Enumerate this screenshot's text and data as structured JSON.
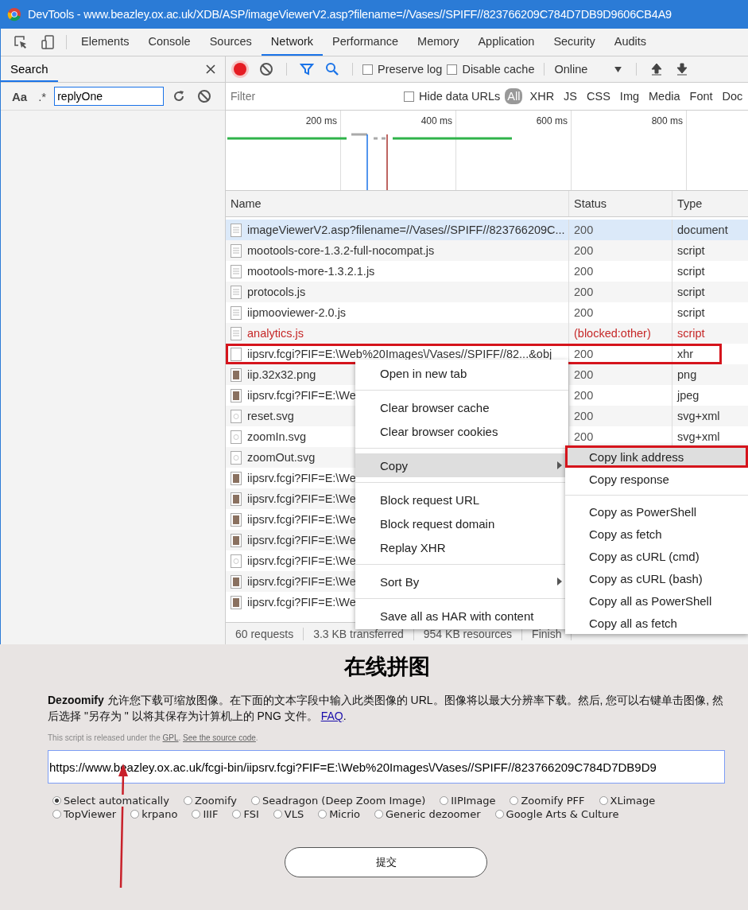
{
  "window": {
    "title": "DevTools - www.beazley.ox.ac.uk/XDB/ASP/imageViewerV2.asp?filename=//Vases//SPIFF//823766209C784D7DB9D9606CB4A9"
  },
  "devtools_tabs": [
    {
      "label": "Elements",
      "selected": false
    },
    {
      "label": "Console",
      "selected": false
    },
    {
      "label": "Sources",
      "selected": false
    },
    {
      "label": "Network",
      "selected": true
    },
    {
      "label": "Performance",
      "selected": false
    },
    {
      "label": "Memory",
      "selected": false
    },
    {
      "label": "Application",
      "selected": false
    },
    {
      "label": "Security",
      "selected": false
    },
    {
      "label": "Audits",
      "selected": false
    }
  ],
  "search_panel": {
    "title": "Search",
    "case_toggle": "Aa",
    "regex_toggle": ".*",
    "query": "replyOne"
  },
  "network_toolbar": {
    "recording": true,
    "preserve_log": {
      "label": "Preserve log",
      "checked": false
    },
    "disable_cache": {
      "label": "Disable cache",
      "checked": false
    },
    "throttling": "Online"
  },
  "filter_bar": {
    "placeholder": "Filter",
    "hide_data_urls": {
      "label": "Hide data URLs",
      "checked": false
    },
    "types": [
      {
        "label": "All",
        "selected": true
      },
      {
        "label": "XHR",
        "selected": false
      },
      {
        "label": "JS",
        "selected": false
      },
      {
        "label": "CSS",
        "selected": false
      },
      {
        "label": "Img",
        "selected": false
      },
      {
        "label": "Media",
        "selected": false
      },
      {
        "label": "Font",
        "selected": false
      },
      {
        "label": "Doc",
        "selected": false
      }
    ]
  },
  "timeline": {
    "ticks": [
      "200 ms",
      "400 ms",
      "600 ms",
      "800 ms"
    ]
  },
  "table": {
    "columns": [
      "Name",
      "Status",
      "Type"
    ],
    "rows": [
      {
        "kind": "file",
        "name": "imageViewerV2.asp?filename=//Vases//SPIFF//823766209C...",
        "status": "200",
        "type": "document",
        "error": false,
        "selected": true,
        "annotated": false
      },
      {
        "kind": "file",
        "name": "mootools-core-1.3.2-full-nocompat.js",
        "status": "200",
        "type": "script",
        "error": false,
        "selected": false,
        "annotated": false
      },
      {
        "kind": "file",
        "name": "mootools-more-1.3.2.1.js",
        "status": "200",
        "type": "script",
        "error": false,
        "selected": false,
        "annotated": false
      },
      {
        "kind": "file",
        "name": "protocols.js",
        "status": "200",
        "type": "script",
        "error": false,
        "selected": false,
        "annotated": false
      },
      {
        "kind": "file",
        "name": "iipmooviewer-2.0.js",
        "status": "200",
        "type": "script",
        "error": false,
        "selected": false,
        "annotated": false
      },
      {
        "kind": "file",
        "name": "analytics.js",
        "status": "(blocked:other)",
        "type": "script",
        "error": true,
        "selected": false,
        "annotated": false
      },
      {
        "kind": "blank",
        "name": "iipsrv.fcgi?FIF=E:\\Web%20Images\\/Vases//SPIFF//82...&obj",
        "status": "200",
        "type": "xhr",
        "error": false,
        "selected": false,
        "annotated": true
      },
      {
        "kind": "thumb",
        "name": "iip.32x32.png",
        "status": "200",
        "type": "png",
        "error": false,
        "selected": false,
        "annotated": false
      },
      {
        "kind": "thumb",
        "name": "iipsrv.fcgi?FIF=E:\\We",
        "status": "200",
        "type": "jpeg",
        "error": false,
        "selected": false,
        "annotated": false
      },
      {
        "kind": "svg",
        "name": "reset.svg",
        "status": "200",
        "type": "svg+xml",
        "error": false,
        "selected": false,
        "annotated": false
      },
      {
        "kind": "svg",
        "name": "zoomIn.svg",
        "status": "200",
        "type": "svg+xml",
        "error": false,
        "selected": false,
        "annotated": false
      },
      {
        "kind": "svg",
        "name": "zoomOut.svg",
        "error": false,
        "selected": false,
        "annotated": false
      },
      {
        "kind": "thumb",
        "name": "iipsrv.fcgi?FIF=E:\\We",
        "error": false,
        "selected": false,
        "annotated": false
      },
      {
        "kind": "thumb",
        "name": "iipsrv.fcgi?FIF=E:\\We",
        "error": false,
        "selected": false,
        "annotated": false
      },
      {
        "kind": "thumb",
        "name": "iipsrv.fcgi?FIF=E:\\We",
        "error": false,
        "selected": false,
        "annotated": false
      },
      {
        "kind": "thumb",
        "name": "iipsrv.fcgi?FIF=E:\\We",
        "error": false,
        "selected": false,
        "annotated": false
      },
      {
        "kind": "svg",
        "name": "iipsrv.fcgi?FIF=E:\\We",
        "error": false,
        "selected": false,
        "annotated": false
      },
      {
        "kind": "thumb",
        "name": "iipsrv.fcgi?FIF=E:\\We",
        "error": false,
        "selected": false,
        "annotated": false
      },
      {
        "kind": "thumb",
        "name": "iipsrv.fcgi?FIF=E:\\We",
        "error": false,
        "selected": false,
        "annotated": false
      }
    ]
  },
  "status_bar": [
    "60 requests",
    "3.3 KB transferred",
    "954 KB resources",
    "Finish"
  ],
  "context_menu": {
    "groups": [
      [
        {
          "label": "Open in new tab",
          "has_submenu": false,
          "highlighted": false
        }
      ],
      [
        {
          "label": "Clear browser cache",
          "has_submenu": false,
          "highlighted": false
        },
        {
          "label": "Clear browser cookies",
          "has_submenu": false,
          "highlighted": false
        }
      ],
      [
        {
          "label": "Copy",
          "has_submenu": true,
          "highlighted": true
        }
      ],
      [
        {
          "label": "Block request URL",
          "has_submenu": false,
          "highlighted": false
        },
        {
          "label": "Block request domain",
          "has_submenu": false,
          "highlighted": false
        },
        {
          "label": "Replay XHR",
          "has_submenu": false,
          "highlighted": false
        }
      ],
      [
        {
          "label": "Sort By",
          "has_submenu": true,
          "highlighted": false
        }
      ],
      [
        {
          "label": "Save all as HAR with content",
          "has_submenu": false,
          "highlighted": false
        }
      ]
    ]
  },
  "submenu": {
    "groups": [
      [
        {
          "label": "Copy link address",
          "highlighted": true,
          "annotated": true
        },
        {
          "label": "Copy response",
          "highlighted": false,
          "annotated": false
        }
      ],
      [
        {
          "label": "Copy as PowerShell",
          "highlighted": false,
          "annotated": false
        },
        {
          "label": "Copy as fetch",
          "highlighted": false,
          "annotated": false
        },
        {
          "label": "Copy as cURL (cmd)",
          "highlighted": false,
          "annotated": false
        },
        {
          "label": "Copy as cURL (bash)",
          "highlighted": false,
          "annotated": false
        },
        {
          "label": "Copy all as PowerShell",
          "highlighted": false,
          "annotated": false
        },
        {
          "label": "Copy all as fetch",
          "highlighted": false,
          "annotated": false
        }
      ]
    ]
  },
  "web_page": {
    "heading": "在线拼图",
    "intro": "**Dezoomify** 允许您下载可缩放图像。在下面的文本字段中输入此类图像的 URL。图像将以最大分辨率下载。然后, 您可以右键单击图像, 然后选择 \"另存为 \" 以将其保存为计算机上的 PNG 文件。",
    "faq_link": "FAQ",
    "intro_end": ".",
    "license": {
      "text": "This script is released under the",
      "gpl_link": "GPL",
      "separator": ".",
      "source_link": "See the source code",
      "end": "."
    },
    "url_value": "https://www.beazley.ox.ac.uk/fcgi-bin/iipsrv.fcgi?FIF=E:\\Web%20Images\\/Vases//SPIFF//823766209C784D7DB9D9",
    "options": [
      {
        "label": "Select automatically",
        "selected": true
      },
      {
        "label": "Zoomify",
        "selected": false
      },
      {
        "label": "Seadragon (Deep Zoom Image)",
        "selected": false
      },
      {
        "label": "IIPImage",
        "selected": false
      },
      {
        "label": "Zoomify PFF",
        "selected": false
      },
      {
        "label": "XLimage",
        "selected": false
      },
      {
        "label": "TopViewer",
        "selected": false
      },
      {
        "label": "krpano",
        "selected": false
      },
      {
        "label": "IIIF",
        "selected": false
      },
      {
        "label": "FSI",
        "selected": false
      },
      {
        "label": "VLS",
        "selected": false
      },
      {
        "label": "Micrio",
        "selected": false
      },
      {
        "label": "Generic dezoomer",
        "selected": false
      },
      {
        "label": "Google Arts & Culture",
        "selected": false
      }
    ],
    "submit": "提交"
  }
}
